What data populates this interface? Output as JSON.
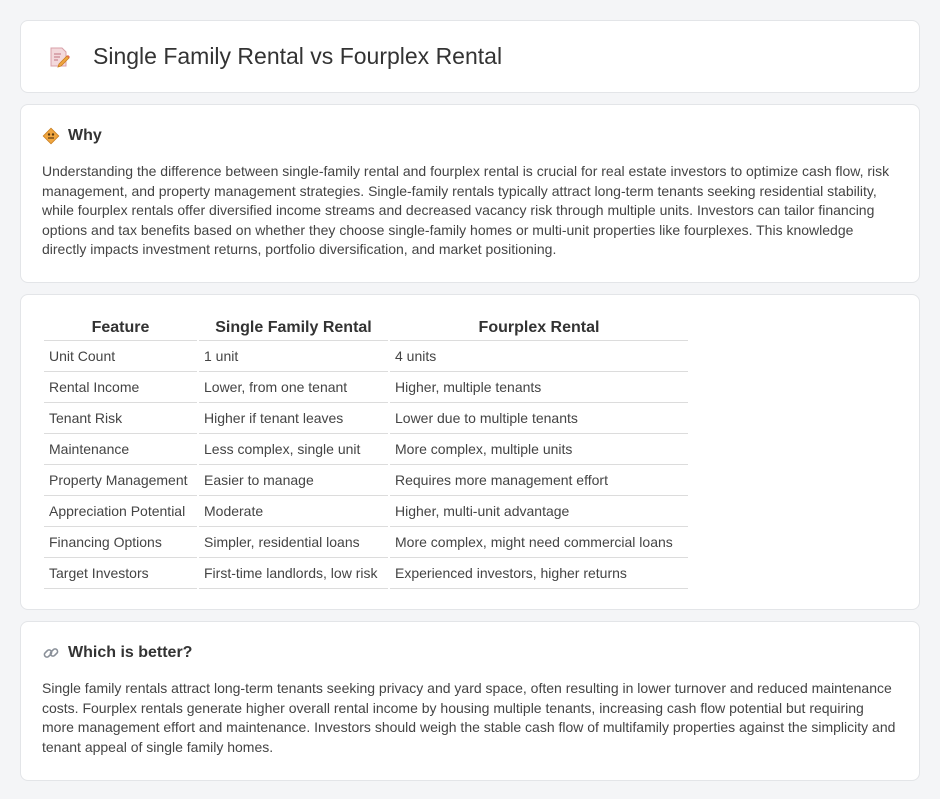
{
  "header": {
    "title": "Single Family Rental vs Fourplex Rental",
    "icon": "document-pencil-icon"
  },
  "why": {
    "icon": "road-sign-icon",
    "title": "Why",
    "text": "Understanding the difference between single-family rental and fourplex rental is crucial for real estate investors to optimize cash flow, risk management, and property management strategies. Single-family rentals typically attract long-term tenants seeking residential stability, while fourplex rentals offer diversified income streams and decreased vacancy risk through multiple units. Investors can tailor financing options and tax benefits based on whether they choose single-family homes or multi-unit properties like fourplexes. This knowledge directly impacts investment returns, portfolio diversification, and market positioning."
  },
  "table": {
    "headers": [
      "Feature",
      "Single Family Rental",
      "Fourplex Rental"
    ],
    "rows": [
      [
        "Unit Count",
        "1 unit",
        "4 units"
      ],
      [
        "Rental Income",
        "Lower, from one tenant",
        "Higher, multiple tenants"
      ],
      [
        "Tenant Risk",
        "Higher if tenant leaves",
        "Lower due to multiple tenants"
      ],
      [
        "Maintenance",
        "Less complex, single unit",
        "More complex, multiple units"
      ],
      [
        "Property Management",
        "Easier to manage",
        "Requires more management effort"
      ],
      [
        "Appreciation Potential",
        "Moderate",
        "Higher, multi-unit advantage"
      ],
      [
        "Financing Options",
        "Simpler, residential loans",
        "More complex, might need commercial loans"
      ],
      [
        "Target Investors",
        "First-time landlords, low risk",
        "Experienced investors, higher returns"
      ]
    ]
  },
  "better": {
    "icon": "link-icon",
    "title": "Which is better?",
    "text": "Single family rentals attract long-term tenants seeking privacy and yard space, often resulting in lower turnover and reduced maintenance costs. Fourplex rentals generate higher overall rental income by housing multiple tenants, increasing cash flow potential but requiring more management effort and maintenance. Investors should weigh the stable cash flow of multifamily properties against the simplicity and tenant appeal of single family homes."
  },
  "colors": {
    "background": "#f4f5f7",
    "card": "#ffffff",
    "border": "#e3e5e8",
    "text": "#333333",
    "icon_accent": "#e8a33a"
  }
}
